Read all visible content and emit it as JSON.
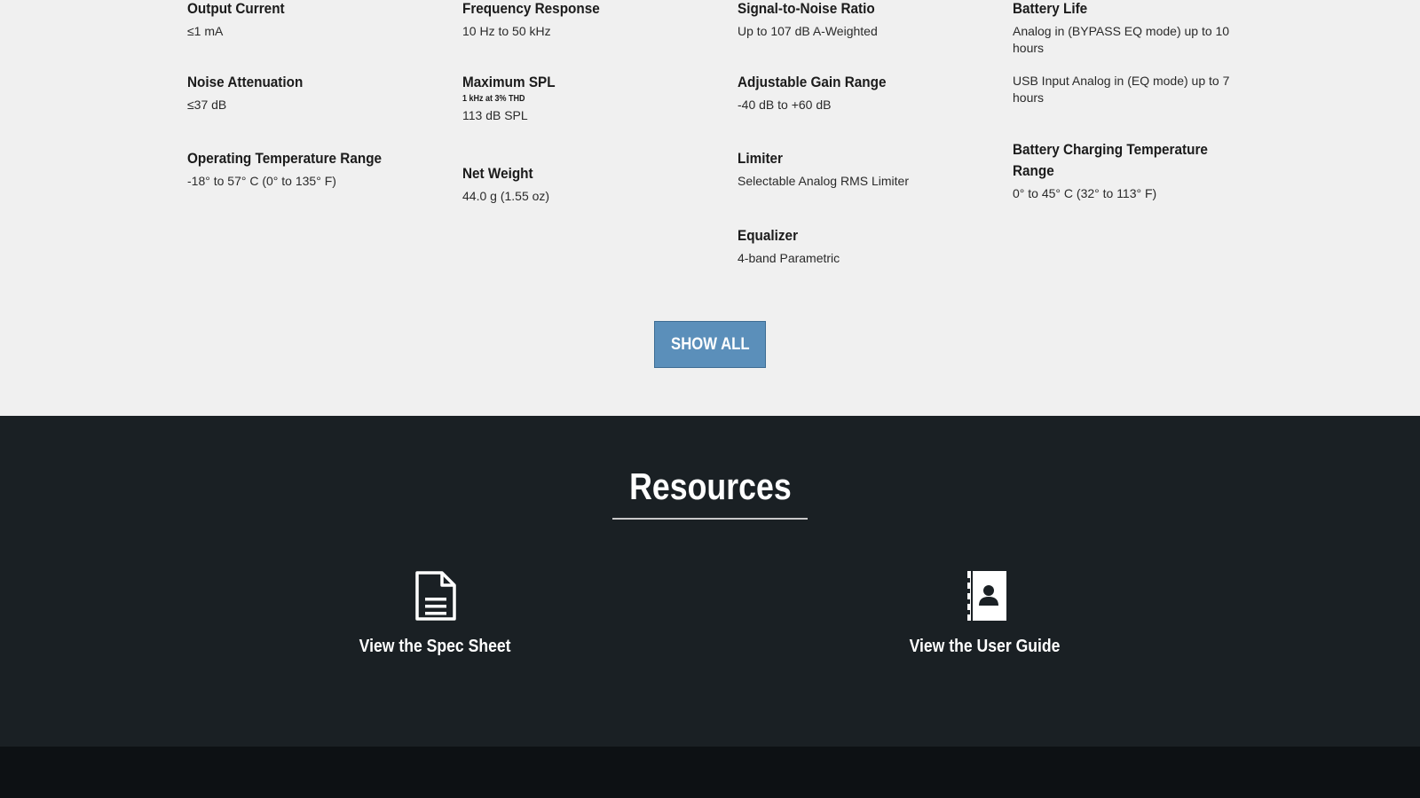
{
  "specs": {
    "col1": [
      {
        "label": "Output Current",
        "value": "≤1 mA"
      },
      {
        "label": "Noise Attenuation",
        "value": "≤37 dB"
      },
      {
        "label": "Operating Temperature Range",
        "value": "-18° to 57° C (0° to 135° F)"
      }
    ],
    "col2": [
      {
        "label": "Frequency Response",
        "value": "10 Hz to 50 kHz"
      },
      {
        "label": "Maximum SPL",
        "note": "1 kHz at 3% THD",
        "value": "113 dB SPL"
      },
      {
        "label": "Net Weight",
        "value": "44.0 g (1.55 oz)"
      }
    ],
    "col3": [
      {
        "label": "Signal-to-Noise Ratio",
        "value": "Up to 107 dB A-Weighted"
      },
      {
        "label": "Adjustable Gain Range",
        "value": "-40 dB to +60 dB"
      },
      {
        "label": "Limiter",
        "value": "Selectable Analog RMS Limiter"
      },
      {
        "label": "Equalizer",
        "value": "4-band Parametric"
      }
    ],
    "col4": [
      {
        "label": "Battery Life",
        "value": "Analog in (BYPASS EQ mode) up to 10 hours",
        "value2": "USB Input Analog in (EQ mode) up to 7 hours"
      },
      {
        "label": "Battery Charging Temperature Range",
        "value": "0° to 45° C (32° to 113° F)"
      }
    ]
  },
  "show_all_label": "SHOW ALL",
  "resources": {
    "title": "Resources",
    "items": [
      {
        "label": "View the Spec Sheet",
        "icon": "document-icon"
      },
      {
        "label": "View the User Guide",
        "icon": "contact-book-icon"
      }
    ]
  },
  "colors": {
    "button_bg": "#5b8fba",
    "resources_bg": "#1a2024",
    "footer_bg": "#0d1114"
  }
}
